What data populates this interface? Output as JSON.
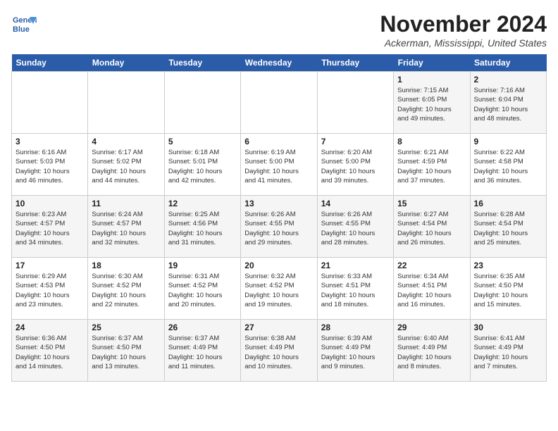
{
  "logo": {
    "line1": "General",
    "line2": "Blue"
  },
  "title": "November 2024",
  "location": "Ackerman, Mississippi, United States",
  "weekdays": [
    "Sunday",
    "Monday",
    "Tuesday",
    "Wednesday",
    "Thursday",
    "Friday",
    "Saturday"
  ],
  "weeks": [
    [
      {
        "num": "",
        "info": ""
      },
      {
        "num": "",
        "info": ""
      },
      {
        "num": "",
        "info": ""
      },
      {
        "num": "",
        "info": ""
      },
      {
        "num": "",
        "info": ""
      },
      {
        "num": "1",
        "info": "Sunrise: 7:15 AM\nSunset: 6:05 PM\nDaylight: 10 hours\nand 49 minutes."
      },
      {
        "num": "2",
        "info": "Sunrise: 7:16 AM\nSunset: 6:04 PM\nDaylight: 10 hours\nand 48 minutes."
      }
    ],
    [
      {
        "num": "3",
        "info": "Sunrise: 6:16 AM\nSunset: 5:03 PM\nDaylight: 10 hours\nand 46 minutes."
      },
      {
        "num": "4",
        "info": "Sunrise: 6:17 AM\nSunset: 5:02 PM\nDaylight: 10 hours\nand 44 minutes."
      },
      {
        "num": "5",
        "info": "Sunrise: 6:18 AM\nSunset: 5:01 PM\nDaylight: 10 hours\nand 42 minutes."
      },
      {
        "num": "6",
        "info": "Sunrise: 6:19 AM\nSunset: 5:00 PM\nDaylight: 10 hours\nand 41 minutes."
      },
      {
        "num": "7",
        "info": "Sunrise: 6:20 AM\nSunset: 5:00 PM\nDaylight: 10 hours\nand 39 minutes."
      },
      {
        "num": "8",
        "info": "Sunrise: 6:21 AM\nSunset: 4:59 PM\nDaylight: 10 hours\nand 37 minutes."
      },
      {
        "num": "9",
        "info": "Sunrise: 6:22 AM\nSunset: 4:58 PM\nDaylight: 10 hours\nand 36 minutes."
      }
    ],
    [
      {
        "num": "10",
        "info": "Sunrise: 6:23 AM\nSunset: 4:57 PM\nDaylight: 10 hours\nand 34 minutes."
      },
      {
        "num": "11",
        "info": "Sunrise: 6:24 AM\nSunset: 4:57 PM\nDaylight: 10 hours\nand 32 minutes."
      },
      {
        "num": "12",
        "info": "Sunrise: 6:25 AM\nSunset: 4:56 PM\nDaylight: 10 hours\nand 31 minutes."
      },
      {
        "num": "13",
        "info": "Sunrise: 6:26 AM\nSunset: 4:55 PM\nDaylight: 10 hours\nand 29 minutes."
      },
      {
        "num": "14",
        "info": "Sunrise: 6:26 AM\nSunset: 4:55 PM\nDaylight: 10 hours\nand 28 minutes."
      },
      {
        "num": "15",
        "info": "Sunrise: 6:27 AM\nSunset: 4:54 PM\nDaylight: 10 hours\nand 26 minutes."
      },
      {
        "num": "16",
        "info": "Sunrise: 6:28 AM\nSunset: 4:54 PM\nDaylight: 10 hours\nand 25 minutes."
      }
    ],
    [
      {
        "num": "17",
        "info": "Sunrise: 6:29 AM\nSunset: 4:53 PM\nDaylight: 10 hours\nand 23 minutes."
      },
      {
        "num": "18",
        "info": "Sunrise: 6:30 AM\nSunset: 4:52 PM\nDaylight: 10 hours\nand 22 minutes."
      },
      {
        "num": "19",
        "info": "Sunrise: 6:31 AM\nSunset: 4:52 PM\nDaylight: 10 hours\nand 20 minutes."
      },
      {
        "num": "20",
        "info": "Sunrise: 6:32 AM\nSunset: 4:52 PM\nDaylight: 10 hours\nand 19 minutes."
      },
      {
        "num": "21",
        "info": "Sunrise: 6:33 AM\nSunset: 4:51 PM\nDaylight: 10 hours\nand 18 minutes."
      },
      {
        "num": "22",
        "info": "Sunrise: 6:34 AM\nSunset: 4:51 PM\nDaylight: 10 hours\nand 16 minutes."
      },
      {
        "num": "23",
        "info": "Sunrise: 6:35 AM\nSunset: 4:50 PM\nDaylight: 10 hours\nand 15 minutes."
      }
    ],
    [
      {
        "num": "24",
        "info": "Sunrise: 6:36 AM\nSunset: 4:50 PM\nDaylight: 10 hours\nand 14 minutes."
      },
      {
        "num": "25",
        "info": "Sunrise: 6:37 AM\nSunset: 4:50 PM\nDaylight: 10 hours\nand 13 minutes."
      },
      {
        "num": "26",
        "info": "Sunrise: 6:37 AM\nSunset: 4:49 PM\nDaylight: 10 hours\nand 11 minutes."
      },
      {
        "num": "27",
        "info": "Sunrise: 6:38 AM\nSunset: 4:49 PM\nDaylight: 10 hours\nand 10 minutes."
      },
      {
        "num": "28",
        "info": "Sunrise: 6:39 AM\nSunset: 4:49 PM\nDaylight: 10 hours\nand 9 minutes."
      },
      {
        "num": "29",
        "info": "Sunrise: 6:40 AM\nSunset: 4:49 PM\nDaylight: 10 hours\nand 8 minutes."
      },
      {
        "num": "30",
        "info": "Sunrise: 6:41 AM\nSunset: 4:49 PM\nDaylight: 10 hours\nand 7 minutes."
      }
    ]
  ]
}
